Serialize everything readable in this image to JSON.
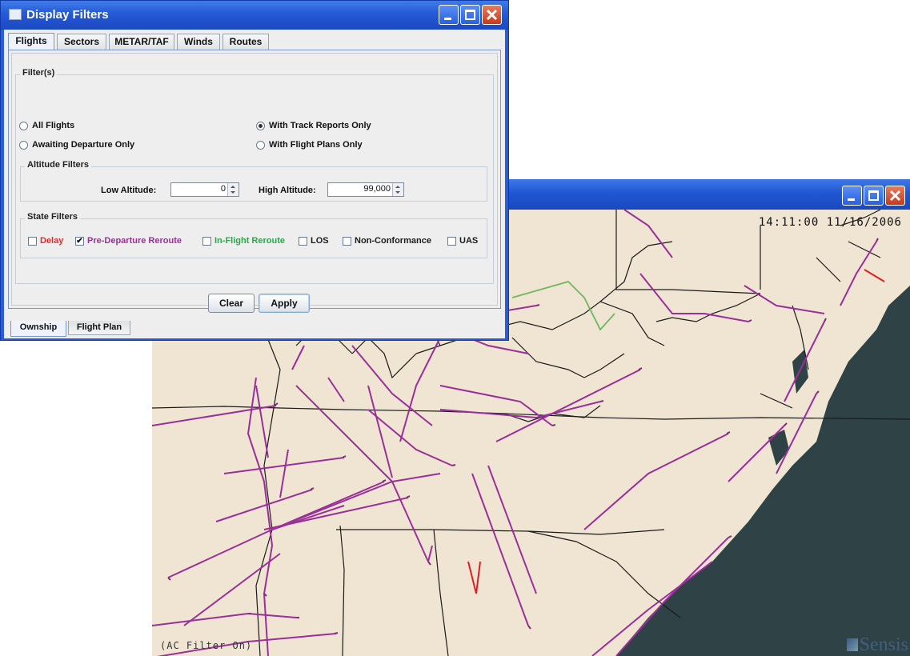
{
  "dialog": {
    "title": "Display Filters",
    "top_tabs": [
      "Flights",
      "Sectors",
      "METAR/TAF",
      "Winds",
      "Routes"
    ],
    "filters_group_label": "Filter(s)",
    "radios": {
      "all_flights": "All Flights",
      "awaiting_departure": "Awaiting Departure Only",
      "with_track_reports": "With Track Reports Only",
      "with_flight_plans": "With Flight Plans Only",
      "selected": "with_track_reports"
    },
    "altitude": {
      "group_label": "Altitude Filters",
      "low_label": "Low Altitude:",
      "low_value": "0",
      "high_label": "High Altitude:",
      "high_value": "99,000"
    },
    "state": {
      "group_label": "State Filters",
      "items": [
        {
          "label": "Delay",
          "checked": false,
          "color": "#e8262a"
        },
        {
          "label": "Pre-Departure Reroute",
          "checked": true,
          "color": "#9b2f99"
        },
        {
          "label": "In-Flight Reroute",
          "checked": false,
          "color": "#2aa84a"
        },
        {
          "label": "LOS",
          "checked": false,
          "color": "#1c1c1c"
        },
        {
          "label": "Non-Conformance",
          "checked": false,
          "color": "#1c1c1c"
        },
        {
          "label": "UAS",
          "checked": false,
          "color": "#1c1c1c"
        }
      ]
    },
    "buttons": {
      "clear": "Clear",
      "apply": "Apply"
    },
    "bottom_tabs": [
      "Ownship",
      "Flight Plan"
    ],
    "window_buttons": [
      "minimize-icon",
      "maximize-icon",
      "close-icon"
    ]
  },
  "map": {
    "clock": "14:11:00 11/16/2006",
    "filter_status": "(AC Filter On)",
    "logo": "Sensis",
    "colors": {
      "land": "#efe5d2",
      "water": "#2f4246",
      "border": "#1a1a1a",
      "reroute_track": "#9b2f99",
      "inflight_track": "#6cb85a",
      "delay_track": "#e02020"
    }
  }
}
